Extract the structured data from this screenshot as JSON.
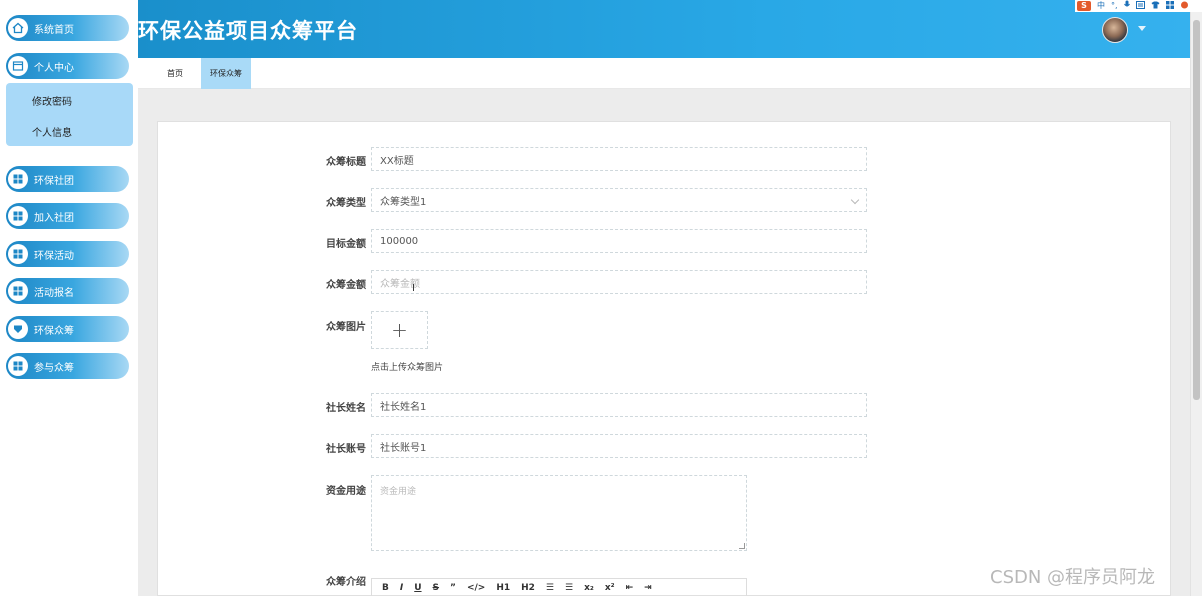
{
  "app": {
    "title": "环保公益项目众筹平台"
  },
  "sidebar": {
    "items": [
      {
        "label": "系统首页",
        "icon": "home-icon"
      },
      {
        "label": "个人中心",
        "icon": "window-icon"
      },
      {
        "label": "环保社团",
        "icon": "grid-icon"
      },
      {
        "label": "加入社团",
        "icon": "grid-icon"
      },
      {
        "label": "环保活动",
        "icon": "grid-icon"
      },
      {
        "label": "活动报名",
        "icon": "grid-icon"
      },
      {
        "label": "环保众筹",
        "icon": "funnel-icon"
      },
      {
        "label": "参与众筹",
        "icon": "grid-icon"
      }
    ],
    "submenu": [
      {
        "label": "修改密码"
      },
      {
        "label": "个人信息"
      }
    ]
  },
  "tray": {
    "ime": "中",
    "s_logo": "S"
  },
  "tabs": [
    {
      "label": "首页"
    },
    {
      "label": "环保众筹",
      "active": true
    }
  ],
  "form": {
    "title": {
      "label": "众筹标题",
      "value": "XX标题"
    },
    "type": {
      "label": "众筹类型",
      "value": "众筹类型1"
    },
    "target": {
      "label": "目标金额",
      "value": "100000"
    },
    "amount": {
      "label": "众筹金额",
      "placeholder": "众筹金额"
    },
    "image": {
      "label": "众筹图片",
      "upload_symbol": "+",
      "hint": "点击上传众筹图片"
    },
    "leader_name": {
      "label": "社长姓名",
      "value": "社长姓名1"
    },
    "leader_account": {
      "label": "社长账号",
      "value": "社长账号1"
    },
    "usage": {
      "label": "资金用途",
      "placeholder": "资金用途"
    },
    "intro": {
      "label": "众筹介绍",
      "toolbar": [
        "B",
        "I",
        "U",
        "S",
        "”",
        "</>",
        "H1",
        "H2",
        "☰",
        "☰",
        "x₂",
        "x²",
        "⇤",
        "⇥"
      ]
    }
  },
  "watermark": "CSDN @程序员阿龙",
  "colors": {
    "header_start": "#1a8fcb",
    "header_end": "#35b1ee",
    "submenu_bg": "#a8d9f8",
    "tab_active": "#a9daf7"
  }
}
